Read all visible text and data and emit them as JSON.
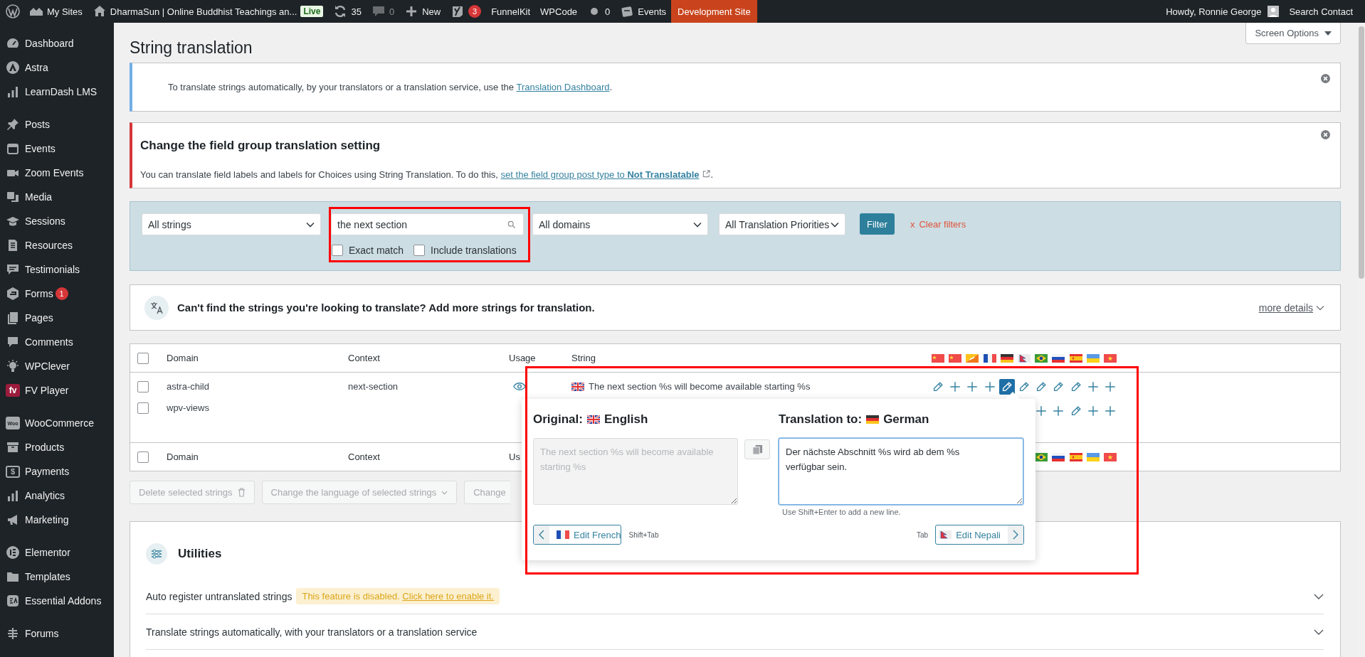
{
  "admin_bar": {
    "items": [
      {
        "label": "My Sites",
        "muted": false,
        "highlighted": false
      },
      {
        "label": "DharmaSun | Online Buddhist Teachings an...",
        "badge": "Live",
        "muted": false,
        "highlighted": false
      },
      {
        "label": "35",
        "muted": false,
        "highlighted": false
      },
      {
        "label": "0",
        "muted": true,
        "highlighted": false
      },
      {
        "label": "New",
        "muted": false,
        "highlighted": false
      },
      {
        "badge": "3",
        "muted": false,
        "highlighted": false
      },
      {
        "label": "FunnelKit",
        "muted": false,
        "highlighted": false
      },
      {
        "label": "WPCode",
        "muted": false,
        "highlighted": false
      },
      {
        "label": "0",
        "muted": false,
        "highlighted": false
      },
      {
        "label": "Events",
        "muted": false,
        "highlighted": false
      },
      {
        "label": "Development Site",
        "muted": false,
        "highlighted": true
      }
    ],
    "greeting": "Howdy, Ronnie George",
    "search_contact": "Search Contact"
  },
  "sidebar": {
    "groups": [
      [
        {
          "label": "Dashboard"
        },
        {
          "label": "Astra"
        },
        {
          "label": "LearnDash LMS"
        }
      ],
      [
        {
          "label": "Posts"
        },
        {
          "label": "Events"
        },
        {
          "label": "Zoom Events"
        },
        {
          "label": "Media"
        },
        {
          "label": "Sessions"
        },
        {
          "label": "Resources"
        },
        {
          "label": "Testimonials"
        },
        {
          "label": "Forms",
          "badge": "1"
        },
        {
          "label": "Pages"
        },
        {
          "label": "Comments"
        },
        {
          "label": "WPClever"
        },
        {
          "label": "FV Player",
          "icon_text": "fv"
        }
      ],
      [
        {
          "label": "WooCommerce",
          "icon_text": "Woo"
        },
        {
          "label": "Products"
        },
        {
          "label": "Payments",
          "icon_text": "$"
        },
        {
          "label": "Analytics"
        },
        {
          "label": "Marketing"
        }
      ],
      [
        {
          "label": "Elementor"
        },
        {
          "label": "Templates"
        },
        {
          "label": "Essential Addons"
        }
      ],
      [
        {
          "label": "Forums"
        }
      ]
    ]
  },
  "page": {
    "title": "String translation",
    "screen_options": "Screen Options"
  },
  "notices": [
    {
      "kind": "info",
      "text": "To translate strings automatically, by your translators or a translation service, use the ",
      "link": "Translation Dashboard",
      "text_after": "."
    },
    {
      "kind": "error",
      "title": "Change the field group translation setting",
      "text": "You can translate field labels and labels for Choices using String Translation. To do this, ",
      "link": "set the field group post type to **Not Translatable**",
      "text_after": "."
    }
  ],
  "filters": {
    "status": "All strings",
    "search": "the next section",
    "domain": "All domains",
    "priority": "All Translation Priorities",
    "filter_button": "Filter",
    "clear_mark": "x",
    "clear_label": "Clear filters",
    "checkboxes": [
      {
        "label": "Exact match",
        "checked": false
      },
      {
        "label": "Include translations",
        "checked": false
      }
    ]
  },
  "add_strings": {
    "text": "Can't find the strings you're looking to translate? Add more strings for translation.",
    "link": "more details"
  },
  "table": {
    "header_checkbox": {
      "checked": false
    },
    "columns": [
      "Domain",
      "Context",
      "Usage",
      "String"
    ],
    "rows": [
      {
        "checked": false,
        "domain": "astra-child",
        "context": "next-section",
        "usage": true,
        "string": "The next section %s will become available starting %s",
        "translations": [
          {
            "kind": "edit",
            "selected": false
          },
          {
            "kind": "add",
            "selected": false
          },
          {
            "kind": "add",
            "selected": false
          },
          {
            "kind": "add",
            "selected": false
          },
          {
            "kind": "edit",
            "selected": true
          },
          {
            "kind": "edit",
            "selected": false
          },
          {
            "kind": "edit",
            "selected": false
          },
          {
            "kind": "edit",
            "selected": false
          },
          {
            "kind": "edit",
            "selected": false
          },
          {
            "kind": "add",
            "selected": false
          },
          {
            "kind": "add",
            "selected": false
          }
        ]
      },
      {
        "checked": false,
        "domain": "wpv-views",
        "usage": false,
        "translations": [
          {
            "kind": "add",
            "selected": false
          },
          {
            "kind": "add",
            "selected": false
          },
          {
            "kind": "edit",
            "selected": false
          },
          {
            "kind": "add",
            "selected": false
          },
          {
            "kind": "add",
            "selected": false
          }
        ]
      }
    ],
    "footer_checkbox": {
      "checked": false
    },
    "footer_columns": [
      "Domain",
      "Context",
      "Us"
    ]
  },
  "bulk_actions": [
    {
      "label": "Delete selected strings",
      "kind": "delete",
      "disabled": true
    },
    {
      "label": "Change the language of selected strings",
      "kind": "dropdown",
      "disabled": true
    },
    {
      "label": "Change",
      "kind": "plain",
      "disabled": true
    }
  ],
  "editor": {
    "original_label": "Original:",
    "original_language": "English",
    "original_text": "The next section %s will become available starting %s",
    "original_disabled": true,
    "target_label": "Translation to:",
    "target_language": "German",
    "translation": "Der nächste Abschnitt %s wird ab dem %s verfügbar sein.",
    "hint": "Use Shift+Enter to add a new line.",
    "prev_button": "Edit French",
    "prev_shortcut": "Shift+Tab",
    "next_shortcut": "Tab",
    "next_button": "Edit Nepali"
  },
  "utilities": {
    "title": "Utilities",
    "rows": [
      {
        "label": "Auto register untranslated strings",
        "notice": "This feature is disabled. ",
        "notice_link": "Click here to enable it.",
        "expanded": false
      },
      {
        "label": "Translate strings automatically, with your translators or a translation service",
        "expanded": false
      }
    ]
  }
}
